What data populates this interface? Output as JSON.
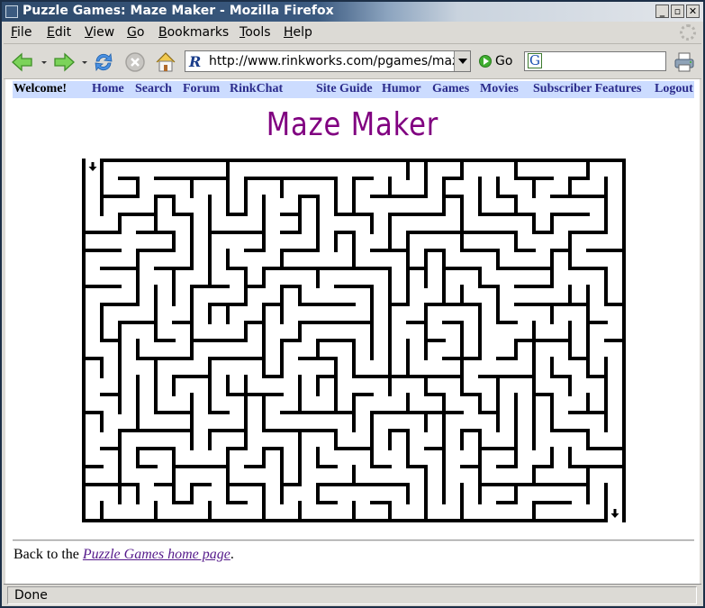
{
  "window": {
    "title": "Puzzle Games: Maze Maker - Mozilla Firefox",
    "buttons": [
      "minimize",
      "maximize",
      "close"
    ]
  },
  "menubar": {
    "items": [
      {
        "label": "File",
        "accel": "F"
      },
      {
        "label": "Edit",
        "accel": "E"
      },
      {
        "label": "View",
        "accel": "V"
      },
      {
        "label": "Go",
        "accel": "G"
      },
      {
        "label": "Bookmarks",
        "accel": "B"
      },
      {
        "label": "Tools",
        "accel": "T"
      },
      {
        "label": "Help",
        "accel": "H"
      }
    ]
  },
  "navbar": {
    "url": "http://www.rinkworks.com/pgames/maze",
    "favicon": "R",
    "go_label": "Go",
    "search_engine_icon": "G",
    "search_value": ""
  },
  "site_nav": {
    "welcome": "Welcome!",
    "links": [
      "Home",
      "Search",
      "Forum",
      "RinkChat",
      "Site Guide",
      "Humor",
      "Games",
      "Movies",
      "Subscriber Features",
      "Logout"
    ]
  },
  "page": {
    "title": "Maze Maker",
    "back_prefix": "Back to the ",
    "back_link": "Puzzle Games home page",
    "back_suffix": "."
  },
  "maze": {
    "cols": 30,
    "rows": 20,
    "entrance": {
      "col": 0,
      "side": "top"
    },
    "exit": {
      "col": 29,
      "side": "bottom"
    },
    "h_walls": [
      [
        0,
        1,
        30
      ],
      [
        1,
        2,
        3
      ],
      [
        1,
        4,
        8
      ],
      [
        1,
        9,
        14
      ],
      [
        1,
        15,
        16
      ],
      [
        1,
        20,
        21
      ],
      [
        1,
        24,
        26
      ],
      [
        1,
        27,
        28
      ],
      [
        2,
        1,
        3
      ],
      [
        2,
        4,
        5
      ],
      [
        2,
        12,
        13
      ],
      [
        2,
        16,
        19
      ],
      [
        2,
        20,
        21
      ],
      [
        2,
        23,
        24
      ],
      [
        2,
        26,
        29
      ],
      [
        3,
        2,
        4
      ],
      [
        3,
        5,
        6
      ],
      [
        3,
        8,
        9
      ],
      [
        3,
        11,
        12
      ],
      [
        3,
        14,
        16
      ],
      [
        3,
        17,
        20
      ],
      [
        3,
        22,
        25
      ],
      [
        3,
        26,
        28
      ],
      [
        4,
        0,
        2
      ],
      [
        4,
        3,
        5
      ],
      [
        4,
        7,
        10
      ],
      [
        4,
        11,
        12
      ],
      [
        4,
        14,
        15
      ],
      [
        4,
        18,
        24
      ],
      [
        4,
        25,
        26
      ],
      [
        4,
        27,
        29
      ],
      [
        5,
        0,
        2
      ],
      [
        5,
        3,
        5
      ],
      [
        5,
        9,
        10
      ],
      [
        5,
        11,
        13
      ],
      [
        5,
        16,
        18
      ],
      [
        5,
        19,
        20
      ],
      [
        5,
        21,
        23
      ],
      [
        5,
        24,
        25
      ],
      [
        5,
        26,
        27
      ],
      [
        5,
        28,
        30
      ],
      [
        6,
        1,
        3
      ],
      [
        6,
        4,
        6
      ],
      [
        6,
        8,
        9
      ],
      [
        6,
        10,
        17
      ],
      [
        6,
        18,
        19
      ],
      [
        6,
        20,
        22
      ],
      [
        6,
        23,
        26
      ],
      [
        6,
        27,
        29
      ],
      [
        7,
        0,
        2
      ],
      [
        7,
        6,
        8
      ],
      [
        7,
        9,
        10
      ],
      [
        7,
        11,
        12
      ],
      [
        7,
        14,
        16
      ],
      [
        7,
        22,
        23
      ],
      [
        7,
        24,
        26
      ],
      [
        8,
        1,
        3
      ],
      [
        8,
        7,
        9
      ],
      [
        8,
        10,
        11
      ],
      [
        8,
        12,
        15
      ],
      [
        8,
        17,
        18
      ],
      [
        8,
        19,
        22
      ],
      [
        8,
        24,
        28
      ],
      [
        8,
        29,
        30
      ],
      [
        9,
        2,
        4
      ],
      [
        9,
        5,
        6
      ],
      [
        9,
        9,
        10
      ],
      [
        9,
        12,
        16
      ],
      [
        9,
        18,
        19
      ],
      [
        9,
        20,
        21
      ],
      [
        9,
        23,
        24
      ],
      [
        9,
        28,
        29
      ],
      [
        10,
        1,
        2
      ],
      [
        10,
        4,
        5
      ],
      [
        10,
        6,
        9
      ],
      [
        10,
        11,
        12
      ],
      [
        10,
        13,
        15
      ],
      [
        10,
        19,
        20
      ],
      [
        10,
        24,
        27
      ],
      [
        10,
        29,
        30
      ],
      [
        11,
        0,
        1
      ],
      [
        11,
        3,
        6
      ],
      [
        11,
        7,
        10
      ],
      [
        11,
        12,
        14
      ],
      [
        11,
        20,
        22
      ],
      [
        11,
        23,
        24
      ],
      [
        11,
        27,
        28
      ],
      [
        12,
        5,
        7
      ],
      [
        12,
        10,
        11
      ],
      [
        12,
        13,
        14
      ],
      [
        12,
        15,
        21
      ],
      [
        12,
        22,
        25
      ],
      [
        12,
        26,
        27
      ],
      [
        12,
        28,
        29
      ],
      [
        13,
        1,
        2
      ],
      [
        13,
        8,
        10
      ],
      [
        13,
        10,
        11
      ],
      [
        13,
        15,
        16
      ],
      [
        13,
        19,
        20
      ],
      [
        13,
        21,
        22
      ],
      [
        13,
        25,
        26
      ],
      [
        14,
        0,
        1
      ],
      [
        14,
        4,
        6
      ],
      [
        14,
        7,
        8
      ],
      [
        14,
        11,
        15
      ],
      [
        14,
        16,
        21
      ],
      [
        14,
        22,
        23
      ],
      [
        14,
        27,
        29
      ],
      [
        15,
        2,
        6
      ],
      [
        15,
        7,
        9
      ],
      [
        15,
        10,
        14
      ],
      [
        15,
        17,
        18
      ],
      [
        15,
        21,
        22
      ],
      [
        15,
        26,
        28
      ],
      [
        16,
        1,
        2
      ],
      [
        16,
        3,
        5
      ],
      [
        16,
        8,
        9
      ],
      [
        16,
        10,
        11
      ],
      [
        16,
        14,
        16
      ],
      [
        16,
        19,
        20
      ],
      [
        16,
        22,
        24
      ],
      [
        16,
        28,
        30
      ],
      [
        17,
        0,
        1
      ],
      [
        17,
        3,
        4
      ],
      [
        17,
        5,
        8
      ],
      [
        17,
        9,
        10
      ],
      [
        17,
        13,
        14
      ],
      [
        17,
        16,
        17
      ],
      [
        17,
        18,
        19
      ],
      [
        17,
        21,
        22
      ],
      [
        17,
        23,
        24
      ],
      [
        17,
        25,
        26
      ],
      [
        17,
        27,
        30
      ],
      [
        18,
        0,
        3
      ],
      [
        18,
        4,
        5
      ],
      [
        18,
        6,
        7
      ],
      [
        18,
        8,
        10
      ],
      [
        18,
        11,
        12
      ],
      [
        18,
        13,
        18
      ],
      [
        18,
        22,
        28
      ],
      [
        19,
        5,
        6
      ],
      [
        19,
        8,
        9
      ],
      [
        19,
        13,
        14
      ],
      [
        19,
        16,
        17
      ],
      [
        19,
        23,
        24
      ],
      [
        19,
        25,
        27
      ],
      [
        20,
        0,
        29
      ]
    ],
    "v_walls": [
      [
        0,
        0,
        20
      ],
      [
        1,
        0,
        3
      ],
      [
        1,
        8,
        10
      ],
      [
        1,
        11,
        12
      ],
      [
        1,
        14,
        15
      ],
      [
        1,
        19,
        20
      ],
      [
        2,
        3,
        4
      ],
      [
        2,
        9,
        14
      ],
      [
        2,
        15,
        19
      ],
      [
        3,
        1,
        2
      ],
      [
        3,
        5,
        8
      ],
      [
        3,
        10,
        11
      ],
      [
        3,
        12,
        15
      ],
      [
        3,
        16,
        17
      ],
      [
        3,
        18,
        19
      ],
      [
        4,
        2,
        4
      ],
      [
        4,
        7,
        10
      ],
      [
        4,
        11,
        14
      ],
      [
        4,
        19,
        20
      ],
      [
        5,
        2,
        3
      ],
      [
        5,
        4,
        5
      ],
      [
        5,
        6,
        8
      ],
      [
        5,
        12,
        13
      ],
      [
        5,
        16,
        19
      ],
      [
        6,
        1,
        2
      ],
      [
        6,
        3,
        6
      ],
      [
        6,
        7,
        11
      ],
      [
        6,
        13,
        16
      ],
      [
        6,
        18,
        19
      ],
      [
        7,
        2,
        7
      ],
      [
        7,
        8,
        9
      ],
      [
        7,
        11,
        14
      ],
      [
        7,
        15,
        16
      ],
      [
        7,
        19,
        20
      ],
      [
        8,
        0,
        3
      ],
      [
        8,
        5,
        6
      ],
      [
        8,
        8,
        9
      ],
      [
        8,
        12,
        13
      ],
      [
        8,
        16,
        19
      ],
      [
        9,
        1,
        3
      ],
      [
        9,
        6,
        8
      ],
      [
        9,
        9,
        10
      ],
      [
        9,
        12,
        16
      ],
      [
        10,
        2,
        5
      ],
      [
        10,
        6,
        7
      ],
      [
        10,
        8,
        12
      ],
      [
        10,
        13,
        15
      ],
      [
        10,
        16,
        17
      ],
      [
        10,
        18,
        20
      ],
      [
        11,
        1,
        2
      ],
      [
        11,
        5,
        6
      ],
      [
        11,
        7,
        9
      ],
      [
        11,
        10,
        12
      ],
      [
        11,
        16,
        19
      ],
      [
        12,
        2,
        4
      ],
      [
        12,
        7,
        8
      ],
      [
        12,
        9,
        10
      ],
      [
        12,
        12,
        14
      ],
      [
        12,
        15,
        18
      ],
      [
        12,
        19,
        20
      ],
      [
        13,
        2,
        5
      ],
      [
        13,
        6,
        7
      ],
      [
        13,
        10,
        11
      ],
      [
        13,
        12,
        13
      ],
      [
        13,
        16,
        17
      ],
      [
        13,
        18,
        19
      ],
      [
        14,
        1,
        3
      ],
      [
        14,
        4,
        5
      ],
      [
        14,
        11,
        14
      ],
      [
        14,
        15,
        16
      ],
      [
        15,
        1,
        3
      ],
      [
        15,
        4,
        6
      ],
      [
        15,
        10,
        12
      ],
      [
        15,
        13,
        15
      ],
      [
        15,
        17,
        18
      ],
      [
        15,
        19,
        20
      ],
      [
        16,
        3,
        4
      ],
      [
        16,
        7,
        11
      ],
      [
        16,
        14,
        17
      ],
      [
        17,
        1,
        2
      ],
      [
        17,
        3,
        5
      ],
      [
        17,
        6,
        13
      ],
      [
        17,
        15,
        16
      ],
      [
        17,
        19,
        20
      ],
      [
        18,
        0,
        1
      ],
      [
        18,
        4,
        8
      ],
      [
        18,
        10,
        12
      ],
      [
        18,
        13,
        14
      ],
      [
        18,
        15,
        17
      ],
      [
        18,
        18,
        19
      ],
      [
        19,
        0,
        2
      ],
      [
        19,
        5,
        7
      ],
      [
        19,
        8,
        11
      ],
      [
        19,
        12,
        13
      ],
      [
        19,
        14,
        15
      ],
      [
        19,
        17,
        20
      ],
      [
        20,
        1,
        3
      ],
      [
        20,
        5,
        8
      ],
      [
        20,
        13,
        19
      ],
      [
        21,
        0,
        1
      ],
      [
        21,
        2,
        5
      ],
      [
        21,
        7,
        8
      ],
      [
        21,
        9,
        13
      ],
      [
        21,
        15,
        16
      ],
      [
        21,
        18,
        20
      ],
      [
        22,
        1,
        3
      ],
      [
        22,
        6,
        7
      ],
      [
        22,
        8,
        11
      ],
      [
        22,
        13,
        14
      ],
      [
        22,
        15,
        19
      ],
      [
        23,
        1,
        2
      ],
      [
        23,
        5,
        6
      ],
      [
        23,
        7,
        9
      ],
      [
        23,
        12,
        15
      ],
      [
        24,
        0,
        1
      ],
      [
        24,
        2,
        3
      ],
      [
        24,
        4,
        5
      ],
      [
        24,
        10,
        11
      ],
      [
        24,
        13,
        17
      ],
      [
        24,
        18,
        19
      ],
      [
        25,
        1,
        2
      ],
      [
        25,
        3,
        4
      ],
      [
        25,
        9,
        16
      ],
      [
        25,
        17,
        18
      ],
      [
        25,
        19,
        20
      ],
      [
        26,
        3,
        4
      ],
      [
        26,
        5,
        7
      ],
      [
        26,
        8,
        9
      ],
      [
        26,
        11,
        12
      ],
      [
        26,
        13,
        15
      ],
      [
        26,
        16,
        17
      ],
      [
        27,
        1,
        2
      ],
      [
        27,
        4,
        6
      ],
      [
        27,
        7,
        8
      ],
      [
        27,
        9,
        11
      ],
      [
        27,
        12,
        13
      ],
      [
        27,
        16,
        17
      ],
      [
        28,
        0,
        1
      ],
      [
        28,
        7,
        12
      ],
      [
        28,
        13,
        14
      ],
      [
        28,
        15,
        16
      ],
      [
        28,
        17,
        19
      ],
      [
        29,
        1,
        4
      ],
      [
        29,
        6,
        8
      ],
      [
        29,
        11,
        15
      ],
      [
        29,
        18,
        20
      ],
      [
        30,
        0,
        20
      ]
    ]
  },
  "status": {
    "text": "Done"
  }
}
